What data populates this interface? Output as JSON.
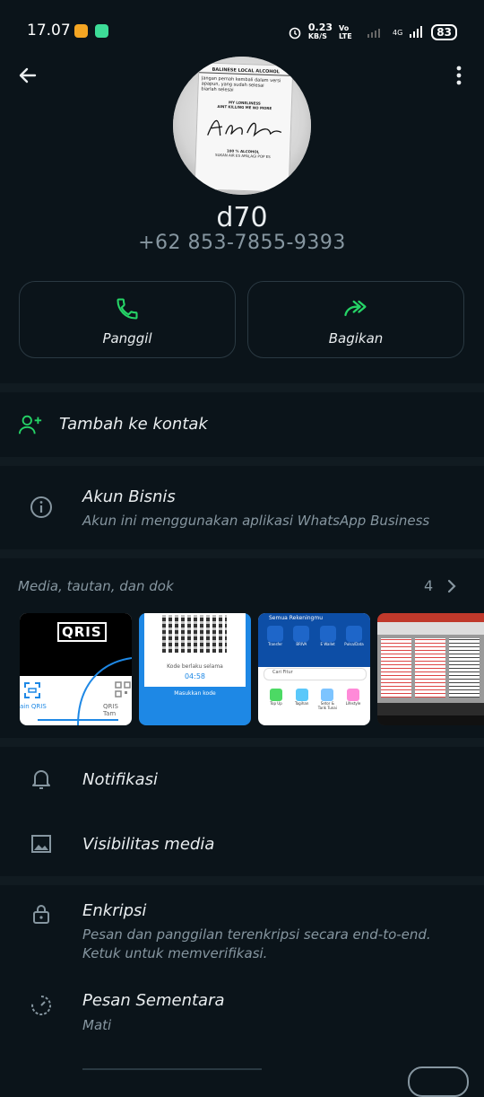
{
  "status_bar": {
    "time": "17.07",
    "net_speed": "0.23",
    "net_unit": "KB/S",
    "net_type": "Vo LTE",
    "net_gen": "4G",
    "battery": "83"
  },
  "header": {
    "back_icon": "arrow-left-icon",
    "menu_icon": "more-vertical-icon"
  },
  "profile": {
    "photo_lines": [
      "BALINESE LOCAL ALCOHOL",
      "Jangan pernah kembali dalam versi",
      "apapun, yang sudah selesai",
      "biarlah selesai",
      "MY LONELINESS",
      "AINT KILLING ME NO MORE",
      "100 % ALCOHOL",
      "SUKAN AIR ES APALAGI POP ES"
    ],
    "name": "d70",
    "phone": "+62 853-7855-9393"
  },
  "actions": [
    {
      "label": "Panggil",
      "icon": "phone-icon"
    },
    {
      "label": "Bagikan",
      "icon": "forward-icon"
    }
  ],
  "add_contact": {
    "label": "Tambah ke kontak",
    "icon": "add-person-icon"
  },
  "business": {
    "title": "Akun Bisnis",
    "subtitle": "Akun ini menggunakan aplikasi WhatsApp Business",
    "icon": "info-icon"
  },
  "media": {
    "title": "Media, tautan, dan dok",
    "count": "4",
    "thumbs": [
      {
        "logo": "QRIS",
        "left_label": "ain QRIS",
        "right_label": "QRIS Tam"
      },
      {
        "text1": "Kode berlaku selama",
        "timer": "04:58",
        "footer": "Masukkan kode"
      },
      {
        "header": "Semua Rekeningmu",
        "items": [
          "Transfer",
          "BRIVA",
          "E Wallet",
          "Pulsa/Data"
        ],
        "search": "Cari Fitur",
        "items2": [
          "Top Up",
          "Tagihan",
          "Setor & Tarik Tunai",
          "Lifestyle"
        ]
      },
      {}
    ]
  },
  "settings": {
    "notif": {
      "title": "Notifikasi",
      "icon": "bell-icon"
    },
    "visibility": {
      "title": "Visibilitas media",
      "icon": "image-icon"
    },
    "encryption": {
      "title": "Enkripsi",
      "subtitle_line1": "Pesan dan panggilan terenkripsi secara end-to-end.",
      "subtitle_line2": "Ketuk untuk memverifikasi.",
      "icon": "lock-icon"
    },
    "disappearing": {
      "title": "Pesan Sementara",
      "subtitle": "Mati",
      "icon": "timer-icon"
    }
  },
  "colors": {
    "accent": "#25d366",
    "bg": "#0b141a",
    "band": "#111b21",
    "secondary_text": "#8696a0"
  }
}
